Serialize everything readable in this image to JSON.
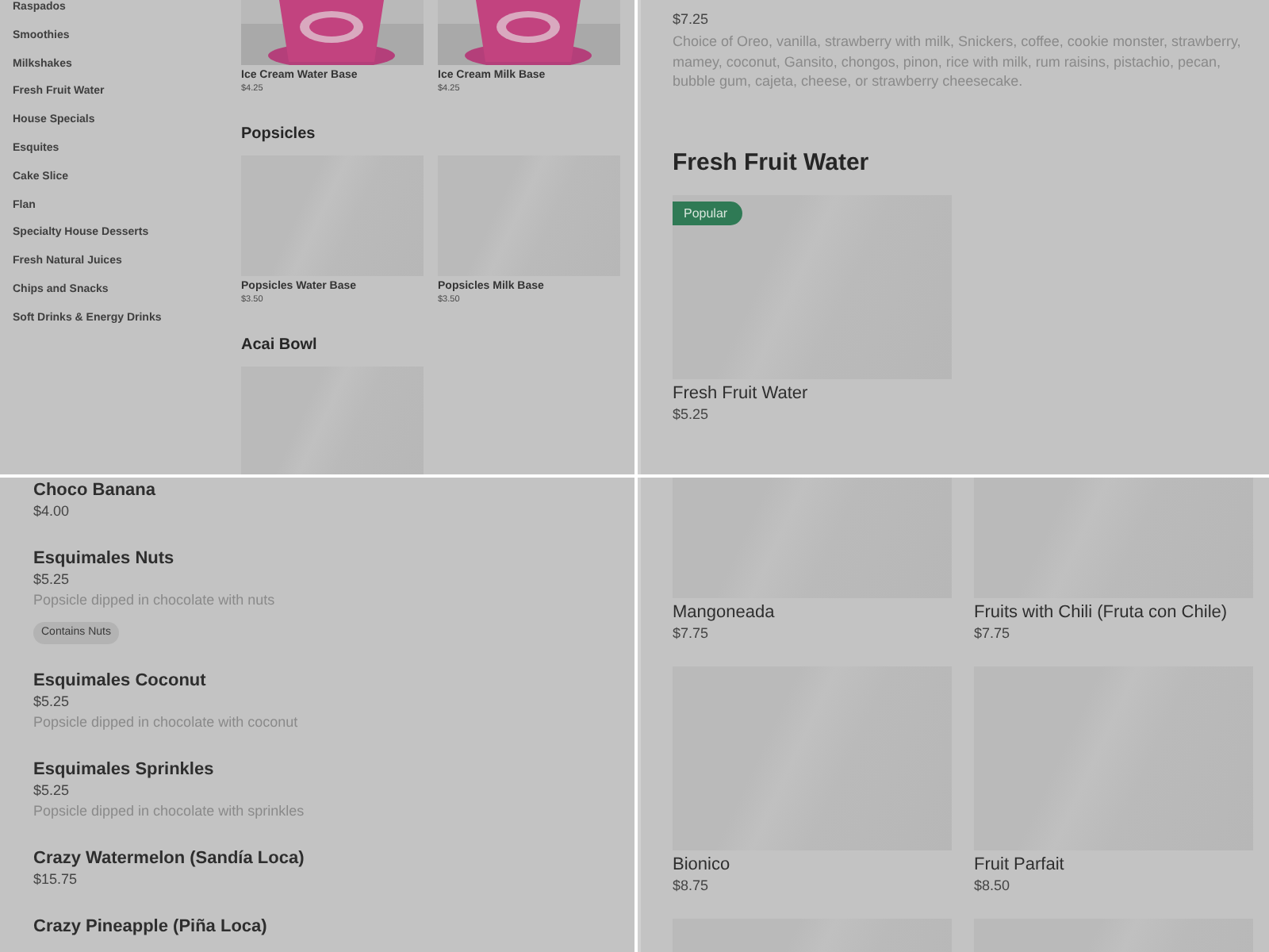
{
  "panels": [
    {
      "kind": "sidebar_menu",
      "sidebar": {
        "items": [
          "Raspados",
          "Smoothies",
          "Milkshakes",
          "Fresh Fruit Water",
          "House Specials",
          "Esquites",
          "Cake Slice",
          "Flan",
          "Specialty House Desserts",
          "Fresh Natural Juices",
          "Chips and Snacks",
          "Soft Drinks & Energy Drinks"
        ]
      },
      "sections": [
        {
          "items": [
            {
              "name": "Ice Cream Water Base",
              "price": "$4.25"
            },
            {
              "name": "Ice Cream Milk Base",
              "price": "$4.25"
            }
          ]
        },
        {
          "title": "Popsicles",
          "items": [
            {
              "kind": "placeholder",
              "name": "Popsicles Water Base",
              "price": "$3.50"
            },
            {
              "kind": "placeholder",
              "name": "Popsicles Milk Base",
              "price": "$3.50"
            }
          ]
        },
        {
          "title": "Acai Bowl",
          "items": [
            {
              "kind": "placeholder"
            }
          ]
        }
      ]
    },
    {
      "kind": "grid",
      "sections": [
        {
          "items": [
            {
              "kind": "text",
              "price": "$7.25",
              "description": "Choice of Oreo, vanilla, strawberry with milk, Snickers, coffee, cookie monster, strawberry, mamey, coconut, Gansito, chongos, pinon, rice with milk, rum raisins, pistachio, pecan, bubble gum, cajeta, cheese, or strawberry cheesecake."
            }
          ]
        },
        {
          "title": "Fresh Fruit Water",
          "items": [
            {
              "kind": "placeholder",
              "name": "Fresh Fruit Water",
              "price": "$5.25",
              "badge": "Popular"
            }
          ]
        }
      ]
    },
    {
      "kind": "list",
      "sections": [
        {
          "items": [
            {
              "kind": "text",
              "name": "Choco Banana",
              "price": "$4.00"
            },
            {
              "kind": "text",
              "name": "Esquimales Nuts",
              "price": "$5.25",
              "description": "Popsicle dipped in chocolate with nuts",
              "tag": "Contains Nuts"
            },
            {
              "kind": "text",
              "name": "Esquimales Coconut",
              "price": "$5.25",
              "description": "Popsicle dipped in chocolate with coconut"
            },
            {
              "kind": "text",
              "name": "Esquimales Sprinkles",
              "price": "$5.25",
              "description": "Popsicle dipped in chocolate with sprinkles"
            },
            {
              "kind": "text",
              "name": "Crazy Watermelon (Sandía Loca)",
              "price": "$15.75"
            },
            {
              "kind": "text",
              "name": "Crazy Pineapple (Piña Loca)"
            }
          ]
        }
      ]
    },
    {
      "kind": "grid",
      "sections": [
        {
          "items": [
            {
              "kind": "placeholder",
              "name": "Mangoneada",
              "price": "$7.75"
            },
            {
              "kind": "placeholder",
              "name": "Fruits with Chili (Fruta con Chile)",
              "price": "$7.75"
            },
            {
              "kind": "placeholder",
              "name": "Bionico",
              "price": "$8.75"
            },
            {
              "kind": "placeholder",
              "name": "Fruit Parfait",
              "price": "$8.50"
            },
            {
              "kind": "placeholder"
            },
            {
              "kind": "placeholder"
            }
          ]
        }
      ]
    }
  ]
}
